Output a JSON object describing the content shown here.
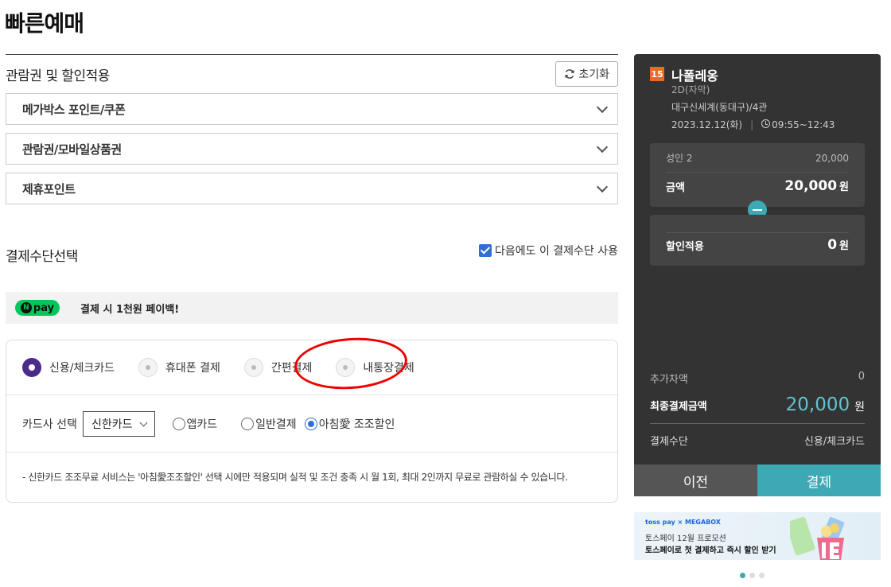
{
  "page": {
    "title": "빠른예매"
  },
  "discount": {
    "title": "관람권 및 할인적용",
    "reset_label": "초기화",
    "items": [
      {
        "label": "메가박스 포인트/쿠폰"
      },
      {
        "label": "관람권/모바일상품권"
      },
      {
        "label": "제휴포인트"
      }
    ]
  },
  "payment": {
    "title": "결제수단선택",
    "remember_label": "다음에도 이 결제수단 사용",
    "npay": {
      "logo": "pay",
      "promo": "결제 시 1천원 페이백!"
    },
    "methods": [
      {
        "label": "신용/체크카드",
        "selected": true
      },
      {
        "label": "휴대폰 결제",
        "selected": false
      },
      {
        "label": "간편결제",
        "selected": false
      },
      {
        "label": "내통장결제",
        "selected": false
      }
    ],
    "card": {
      "label": "카드사 선택",
      "selected_card": "신한카드",
      "options": [
        {
          "label": "앱카드",
          "selected": false
        },
        {
          "label": "일반결제",
          "selected": false
        },
        {
          "label": "아침愛 조조할인",
          "selected": true
        }
      ]
    },
    "notice": "-  신한카드 조조무료 서비스는 '아침愛조조할인' 선택 시에만 적용되며 실적 및 조건 충족 시 월 1회, 최대 2인까지 무료로 관람하실 수 있습니다."
  },
  "summary": {
    "rating": "15",
    "movie_title": "나폴레옹",
    "format": "2D(자막)",
    "theater": "대구신세계(동대구)/4관",
    "date": "2023.12.12(화)",
    "separator": "|",
    "time": "09:55~12:43",
    "ticket_label": "성인 2",
    "ticket_price": "20,000",
    "amount_label": "금액",
    "amount": "20,000",
    "won": "원",
    "discount_label": "할인적용",
    "discount_amount": "0",
    "extra_label": "추가차액",
    "extra_amount": "0",
    "final_label": "최종결제금액",
    "final_amount": "20,000",
    "method_label": "결제수단",
    "method_value": "신용/체크카드",
    "prev_label": "이전",
    "pay_label": "결제"
  },
  "banner": {
    "brand": "toss pay × MEGABOX",
    "line1": "토스페이 12월 프로모션",
    "line2": "토스페이로 첫 결제하고 즉시 할인 받기",
    "slide_index": 0,
    "slide_count": 3
  },
  "colors": {
    "accent": "#3fa8b5",
    "panel": "#333333",
    "radio_selected": "#4b2a8c",
    "highlight": "#ee0000"
  }
}
